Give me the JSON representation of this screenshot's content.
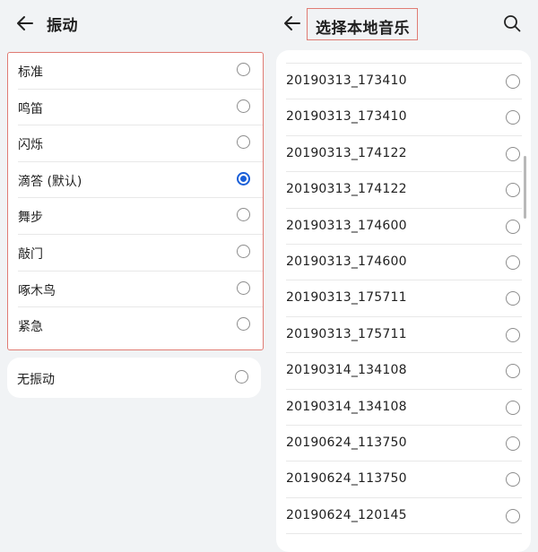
{
  "vibration_screen": {
    "title": "振动",
    "options": [
      {
        "label": "标准",
        "selected": false
      },
      {
        "label": "鸣笛",
        "selected": false
      },
      {
        "label": "闪烁",
        "selected": false
      },
      {
        "label": "滴答 (默认)",
        "selected": true
      },
      {
        "label": "舞步",
        "selected": false
      },
      {
        "label": "敲门",
        "selected": false
      },
      {
        "label": "啄木鸟",
        "selected": false
      },
      {
        "label": "紧急",
        "selected": false
      }
    ],
    "none_option": {
      "label": "无振动",
      "selected": false
    }
  },
  "music_screen": {
    "title": "选择本地音乐",
    "songs": [
      "20190313_173410",
      "20190313_173410",
      "20190313_174122",
      "20190313_174122",
      "20190313_174600",
      "20190313_174600",
      "20190313_175711",
      "20190313_175711",
      "20190314_134108",
      "20190314_134108",
      "20190624_113750",
      "20190624_113750",
      "20190624_120145"
    ]
  },
  "colors": {
    "accent": "#1a5fd8",
    "highlight_box": "#e07b73",
    "background": "#f1f3f5"
  },
  "icons": {
    "back": "back-arrow-icon",
    "search": "search-icon"
  }
}
